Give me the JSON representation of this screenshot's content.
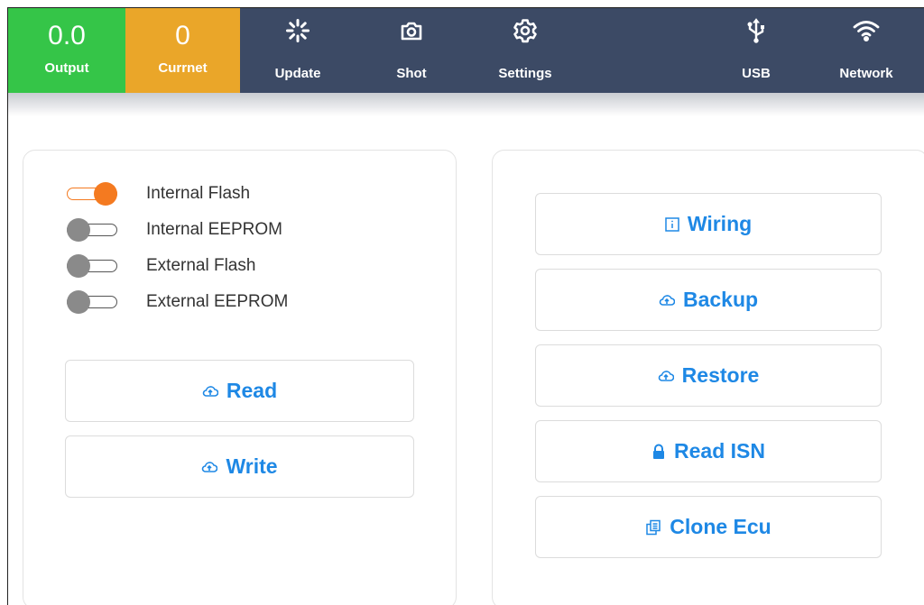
{
  "header": {
    "output": {
      "value": "0.0",
      "label": "Output",
      "color": "#35c548"
    },
    "current": {
      "value": "0",
      "label": "Currnet",
      "color": "#eaa629"
    },
    "nav": [
      {
        "label": "Update",
        "icon": "spinner-icon"
      },
      {
        "label": "Shot",
        "icon": "camera-icon"
      },
      {
        "label": "Settings",
        "icon": "gear-icon"
      },
      {
        "label": "USB",
        "icon": "usb-icon"
      },
      {
        "label": "Network",
        "icon": "wifi-icon"
      }
    ],
    "background": "#3c4a65"
  },
  "memory_options": [
    {
      "label": "Internal Flash",
      "on": true
    },
    {
      "label": "Internal EEPROM",
      "on": false
    },
    {
      "label": "External Flash",
      "on": false
    },
    {
      "label": "External EEPROM",
      "on": false
    }
  ],
  "left_actions": {
    "read": {
      "label": "Read",
      "icon": "cloud-upload-icon"
    },
    "write": {
      "label": "Write",
      "icon": "cloud-upload-icon"
    }
  },
  "right_actions": {
    "wiring": {
      "label": "Wiring",
      "icon": "info-icon"
    },
    "backup": {
      "label": "Backup",
      "icon": "cloud-upload-icon"
    },
    "restore": {
      "label": "Restore",
      "icon": "cloud-upload-icon"
    },
    "read_isn": {
      "label": "Read ISN",
      "icon": "lock-icon"
    },
    "clone_ecu": {
      "label": "Clone Ecu",
      "icon": "copy-icon"
    }
  },
  "colors": {
    "accent": "#1e88e5",
    "toggle_on": "#f47a20",
    "toggle_off": "#8a8a8a"
  }
}
